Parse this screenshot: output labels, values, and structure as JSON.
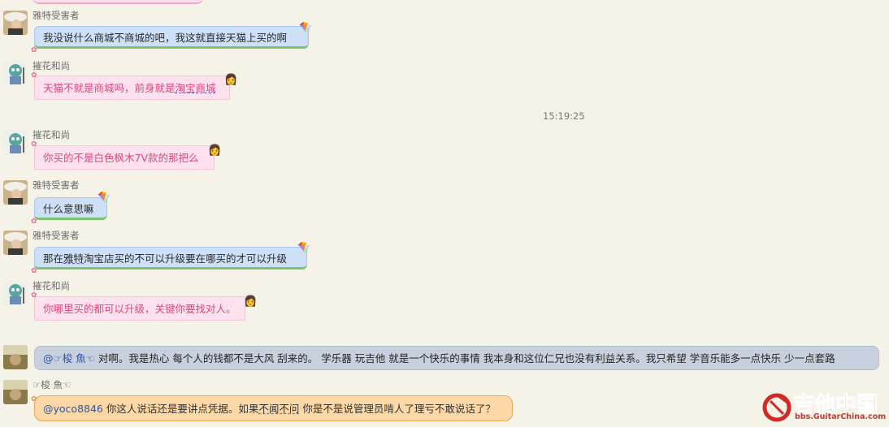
{
  "timestamp": "15:19:25",
  "messages": [
    {
      "sender": "雅特受害者",
      "text": "我没说什么商城不商城的吧，我这就直接天猫上买的啊"
    },
    {
      "sender": "摧花和尚",
      "text_pre": "天猫不就是商城吗，前身就是",
      "text_link": "淘宝商城"
    },
    {
      "sender": "摧花和尚",
      "text": "你买的不是白色枫木7V款的那把么"
    },
    {
      "sender": "雅特受害者",
      "text": "什么意思嘛"
    },
    {
      "sender": "雅特受害者",
      "text_pre": "那在",
      "text_link": "雅特",
      "text_post": "淘宝店买的不可以升级要在哪买的才可以升级"
    },
    {
      "sender": "摧花和尚",
      "text": "你哪里买的都可以升级，关键你要找对人。"
    },
    {
      "sender": "",
      "mention": "@☞梭 魚☜",
      "text": " 对啊。我是热心 每个人的钱都不是大风 刮来的。 学乐器 玩吉他 就是一个快乐的事情 我本身和这位仁兄也没有利益关系。我只希望 学音乐能多一点快乐 少一点套路"
    },
    {
      "sender": "☞梭 魚☜",
      "mention": "@yoco8846",
      "text_pre": " 你这人说话还是要讲点凭据。如果",
      "text_link": "不闻不问",
      "text_post": " 你是不是说管理员啃人了理亏不敢说话了？"
    }
  ],
  "watermark": {
    "title": "吉他中国",
    "url": "bbs.GuitarChina.com"
  },
  "colors": {
    "background": "#f5f2e7",
    "pink_text": "#e0457a",
    "brand_red": "#cf2a26"
  }
}
